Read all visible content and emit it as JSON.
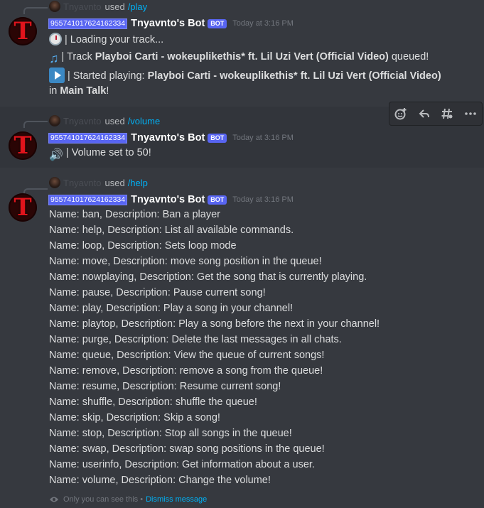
{
  "messages": [
    {
      "reply": {
        "user": "Tnyavnto",
        "used": "used",
        "command": "/play"
      },
      "user_id": "955741017624162334",
      "bot_name": "Tnyavnto's Bot",
      "bot_tag": "BOT",
      "timestamp": "Today at 3:16 PM",
      "lines": {
        "loading": "| Loading your track...",
        "queued_prefix": "| Track ",
        "queued_track": "Playboi Carti - wokeuplikethis* ft. Lil Uzi Vert (Official Video)",
        "queued_suffix": " queued!",
        "started_prefix": "| Started playing: ",
        "started_track": "Playboi Carti - wokeuplikethis* ft. Lil Uzi Vert (Official Video)",
        "in_prefix": "in ",
        "channel": "Main Talk",
        "in_suffix": "!"
      }
    },
    {
      "reply": {
        "user": "Tnyavnto",
        "used": "used",
        "command": "/volume"
      },
      "user_id": "955741017624162334",
      "bot_name": "Tnyavnto's Bot",
      "bot_tag": "BOT",
      "timestamp": "Today at 3:16 PM",
      "lines": {
        "volume": "| Volume set to 50!"
      }
    },
    {
      "reply": {
        "user": "Tnyavnto",
        "used": "used",
        "command": "/help"
      },
      "user_id": "955741017624162334",
      "bot_name": "Tnyavnto's Bot",
      "bot_tag": "BOT",
      "timestamp": "Today at 3:16 PM",
      "commands": [
        "Name: ban, Description: Ban a player",
        "Name: help, Description: List all available commands.",
        "Name: loop, Description: Sets loop mode",
        "Name: move, Description: move song position in the queue!",
        "Name: nowplaying, Description: Get the song that is currently playing.",
        "Name: pause, Description: Pause current song!",
        "Name: play, Description: Play a song in your channel!",
        "Name: playtop, Description: Play a song before the next in your channel!",
        "Name: purge, Description: Delete the last messages in all chats.",
        "Name: queue, Description: View the queue of current songs!",
        "Name: remove, Description: remove a song from the queue!",
        "Name: resume, Description: Resume current song!",
        "Name: shuffle, Description: shuffle the queue!",
        "Name: skip, Description: Skip a song!",
        "Name: stop, Description: Stop all songs in the queue!",
        "Name: swap, Description: swap song positions in the queue!",
        "Name: userinfo, Description: Get information about a user.",
        "Name: volume, Description: Change the volume!"
      ],
      "ephemeral": {
        "note": "Only you can see this •",
        "dismiss": "Dismiss message"
      }
    }
  ],
  "hover_bar": {
    "icons": [
      "add-reaction-icon",
      "reply-icon",
      "create-thread-icon",
      "more-icon"
    ]
  },
  "colors": {
    "background": "#36393f",
    "link": "#00b0f4",
    "bot_tag": "#5865f2",
    "avatar_red": "#e0141c"
  }
}
